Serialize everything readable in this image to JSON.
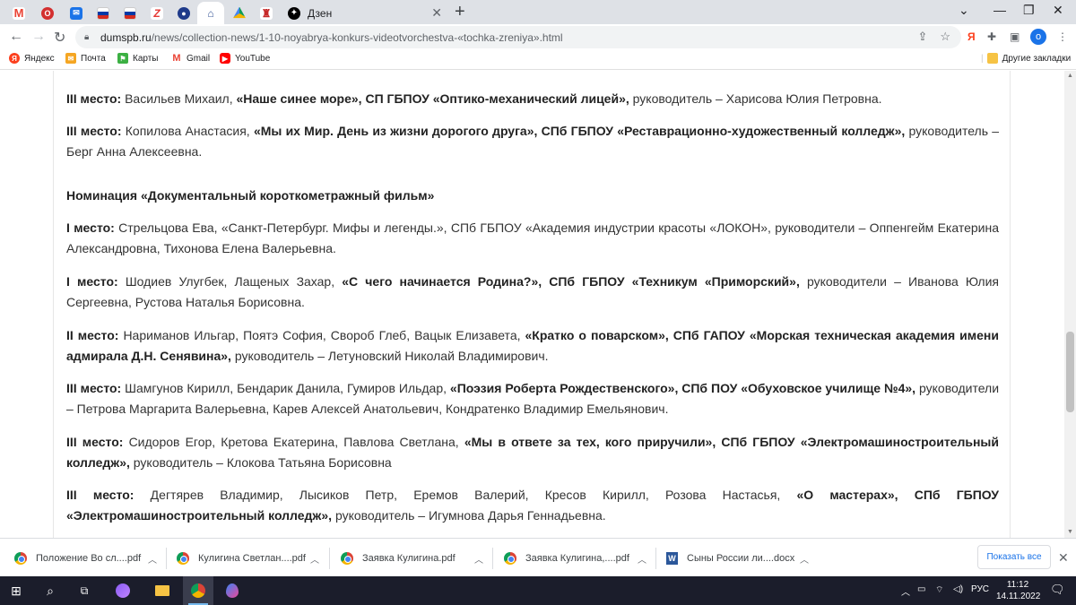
{
  "browser": {
    "tabs": [
      {
        "icon": "gmail-icon",
        "color": "#ea4335"
      },
      {
        "icon": "opera-icon",
        "color": "#d32f2f"
      },
      {
        "icon": "mail-icon",
        "color": "#1a73e8"
      },
      {
        "icon": "russia-flag-icon",
        "color": "#d52b1e"
      },
      {
        "icon": "russia-flag-icon",
        "color": "#d52b1e"
      },
      {
        "icon": "z-icon",
        "color": "#e53935"
      },
      {
        "icon": "disk-icon",
        "color": "#1e88e5"
      },
      {
        "icon": "site-icon",
        "color": "#3b5998"
      },
      {
        "icon": "google-drive-icon",
        "color": "#0f9d58"
      },
      {
        "icon": "emblem-icon",
        "color": "#c62828"
      }
    ],
    "active_tab_title": "Дзен",
    "url_host": "dumspb.ru",
    "url_path": "/news/collection-news/1-10-noyabrya-konkurs-videotvorchestva-«tochka-zreniya».html",
    "profile_initial": "o",
    "bookmarks": [
      {
        "label": "Яндекс",
        "icon": "yandex-icon",
        "color": "#fc3f1d"
      },
      {
        "label": "Почта",
        "icon": "mail-icon",
        "color": "#f5a623"
      },
      {
        "label": "Карты",
        "icon": "maps-icon",
        "color": "#3cb043"
      },
      {
        "label": "Gmail",
        "icon": "gmail-icon",
        "color": "#ea4335"
      },
      {
        "label": "YouTube",
        "icon": "youtube-icon",
        "color": "#ff0000"
      }
    ],
    "other_bookmarks": "Другие закладки"
  },
  "article": {
    "p1": {
      "place": "III место:",
      "names": "Васильев Михаил,",
      "work": "«Наше синее море», СП ГБПОУ «Оптико-механический лицей»,",
      "leader": "руководитель – Харисова Юлия Петровна."
    },
    "p2": {
      "place": "III место:",
      "names": "Копилова Анастасия,",
      "work": "«Мы их Мир. День из жизни дорогого друга», СПб ГБПОУ «Реставрационно-художественный колледж»,",
      "leader": "руководитель – Берг Анна Алексеевна."
    },
    "nomination": "Номинация «Документальный короткометражный фильм»",
    "p3": {
      "place": "I место:",
      "names": "Стрельцова Ева, «Санкт-Петербург. Мифы и легенды.», СПб ГБПОУ «Академия индустрии красоты «ЛОКОН», руководители – Оппенгейм Екатерина Александровна, Тихонова Елена Валерьевна."
    },
    "p4": {
      "place": "I место:",
      "names": "Шодиев Улугбек, Лащеных Захар,",
      "work": "«С чего начинается Родина?», СПб ГБПОУ «Техникум «Приморский»,",
      "leader": "руководители – Иванова Юлия Сергеевна, Рустова Наталья Борисовна."
    },
    "p5": {
      "place": "II место:",
      "names": "Нариманов Ильгар, Поятэ София, Свороб Глеб, Вацык Елизавета,",
      "work": "«Кратко о поварском», СПб ГАПОУ «Морская техническая академия имени адмирала Д.Н. Сенявина»,",
      "leader": "руководитель – Летуновский Николай Владимирович."
    },
    "p6": {
      "place": "III место:",
      "names": "Шамгунов Кирилл, Бендарик Данила, Гумиров Ильдар,",
      "work": "«Поэзия Роберта Рождественского», СПб ПОУ «Обуховское училище №4»,",
      "leader": "руководители – Петрова Маргарита Валерьевна, Карев Алексей Анатольевич, Кондратенко Владимир Емельянович."
    },
    "p7": {
      "place": "III место:",
      "names": "Сидоров Егор, Кретова Екатерина, Павлова Светлана,",
      "work": "«Мы в ответе за тех, кого приручили», СПб ГБПОУ «Электромашиностроительный колледж»,",
      "leader": "руководитель – Клокова Татьяна Борисовна"
    },
    "p8": {
      "place": "III место:",
      "names": "Дегтярев Владимир, Лысиков Петр, Еремов Валерий, Кресов Кирилл, Розова Настасья,",
      "work": "«О мастерах», СПб ГБПОУ «Электромашиностроительный колледж»,",
      "leader": "руководитель – Игумнова Дарья Геннадьевна."
    }
  },
  "downloads": {
    "items": [
      {
        "name": "Положение Во сл....pdf",
        "type": "chrome"
      },
      {
        "name": "Кулигина Светлан....pdf",
        "type": "chrome"
      },
      {
        "name": "Заявка Кулигина.pdf",
        "type": "chrome"
      },
      {
        "name": "Заявка Кулигина,....pdf",
        "type": "chrome"
      },
      {
        "name": "Сыны России ли....docx",
        "type": "word"
      }
    ],
    "show_all": "Показать все"
  },
  "taskbar": {
    "lang": "РУС",
    "time": "11:12",
    "date": "14.11.2022"
  }
}
